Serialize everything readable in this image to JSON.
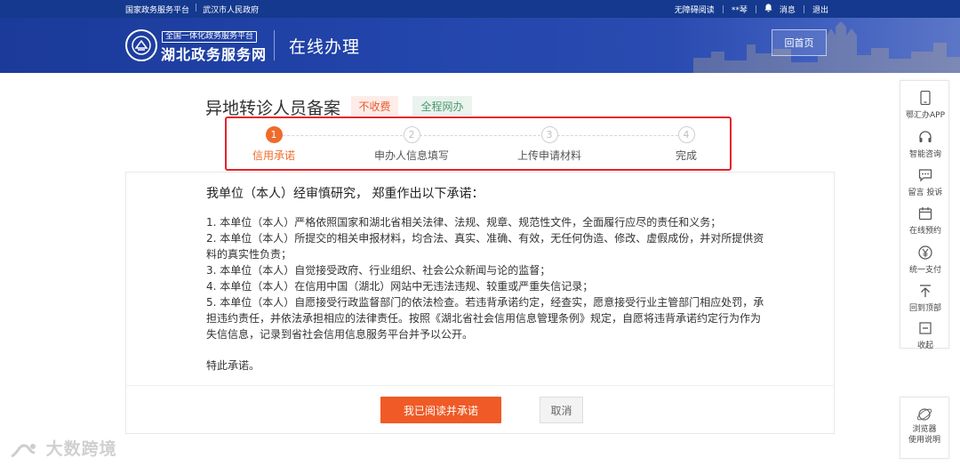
{
  "topbar": {
    "left_links": [
      "国家政务服务平台",
      "武汉市人民政府"
    ],
    "right_links": [
      "无障碍阅读",
      "**琴",
      "消息",
      "退出"
    ]
  },
  "header": {
    "logo_subtitle": "全国一体化政务服务平台",
    "logo_title": "湖北政务服务网",
    "section_title": "在线办理",
    "home_button": "回首页"
  },
  "service": {
    "title": "异地转诊人员备案",
    "tag_fee": "不收费",
    "tag_online": "全程网办"
  },
  "steps": [
    {
      "num": "1",
      "label": "信用承诺"
    },
    {
      "num": "2",
      "label": "申办人信息填写"
    },
    {
      "num": "3",
      "label": "上传申请材料"
    },
    {
      "num": "4",
      "label": "完成"
    }
  ],
  "commitment": {
    "intro": "我单位（本人）经审慎研究， 郑重作出以下承诺：",
    "items": [
      "1. 本单位（本人）严格依照国家和湖北省相关法律、法规、规章、规范性文件，全面履行应尽的责任和义务；",
      "2. 本单位（本人）所提交的相关申报材料，均合法、真实、准确、有效，无任何伪造、修改、虚假成份，并对所提供资料的真实性负责；",
      "3. 本单位（本人）自觉接受政府、行业组织、社会公众新闻与论的监督；",
      "4. 本单位（本人）在信用中国（湖北）网站中无违法违规、较重或严重失信记录；",
      "5. 本单位（本人）自愿接受行政监督部门的依法检查。若违背承诺约定，经查实，愿意接受行业主管部门相应处罚，承担违约责任，并依法承担相应的法律责任。按照《湖北省社会信用信息管理条例》规定，自愿将违背承诺约定行为作为失信信息，记录到省社会信用信息服务平台并予以公开。"
    ],
    "closing": "特此承诺。",
    "confirm_button": "我已阅读并承诺",
    "cancel_button": "取消"
  },
  "side_panel": [
    {
      "icon": "phone-icon",
      "label": "鄂汇办APP"
    },
    {
      "icon": "headset-icon",
      "label": "智能咨询"
    },
    {
      "icon": "message-icon",
      "label": "留言 投诉"
    },
    {
      "icon": "calendar-icon",
      "label": "在线预约"
    },
    {
      "icon": "yen-icon",
      "label": "统一支付"
    },
    {
      "icon": "arrow-up-icon",
      "label": "回到顶部"
    },
    {
      "icon": "collapse-icon",
      "label": "收起"
    }
  ],
  "browser_guide": {
    "line1": "浏览器",
    "line2": "使用说明"
  },
  "watermark": "大数跨境",
  "colors": {
    "header_blue": "#1b3a99",
    "accent_orange": "#ef5a26",
    "highlight_red": "#e3232b"
  }
}
